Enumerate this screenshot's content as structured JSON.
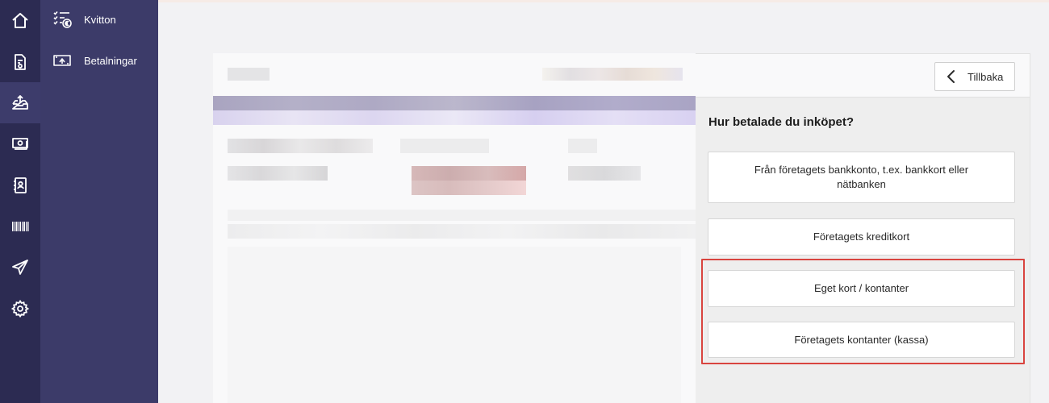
{
  "rail": {
    "items": [
      {
        "icon": "home-icon"
      },
      {
        "icon": "invoice-icon"
      },
      {
        "icon": "inbox-upload-icon",
        "active": true
      },
      {
        "icon": "money-icon"
      },
      {
        "icon": "contacts-book-icon"
      },
      {
        "icon": "barcode-icon"
      },
      {
        "icon": "paper-plane-icon"
      },
      {
        "icon": "gear-icon"
      }
    ]
  },
  "subnav": {
    "items": [
      {
        "label": "Kvitton",
        "icon": "receipt-list-icon"
      },
      {
        "label": "Betalningar",
        "icon": "payments-icon"
      }
    ]
  },
  "panel": {
    "back_label": "Tillbaka",
    "question": "Hur betalade du inköpet?",
    "options": [
      {
        "label": "Från företagets bankkonto, t.ex. bankkort eller nätbanken"
      },
      {
        "label": "Företagets kreditkort"
      },
      {
        "label": "Eget kort / kontanter"
      },
      {
        "label": "Företagets kontanter (kassa)"
      }
    ]
  },
  "colors": {
    "rail_bg": "#2c2b52",
    "subnav_bg": "#3c3b69",
    "highlight": "#d9443f"
  }
}
